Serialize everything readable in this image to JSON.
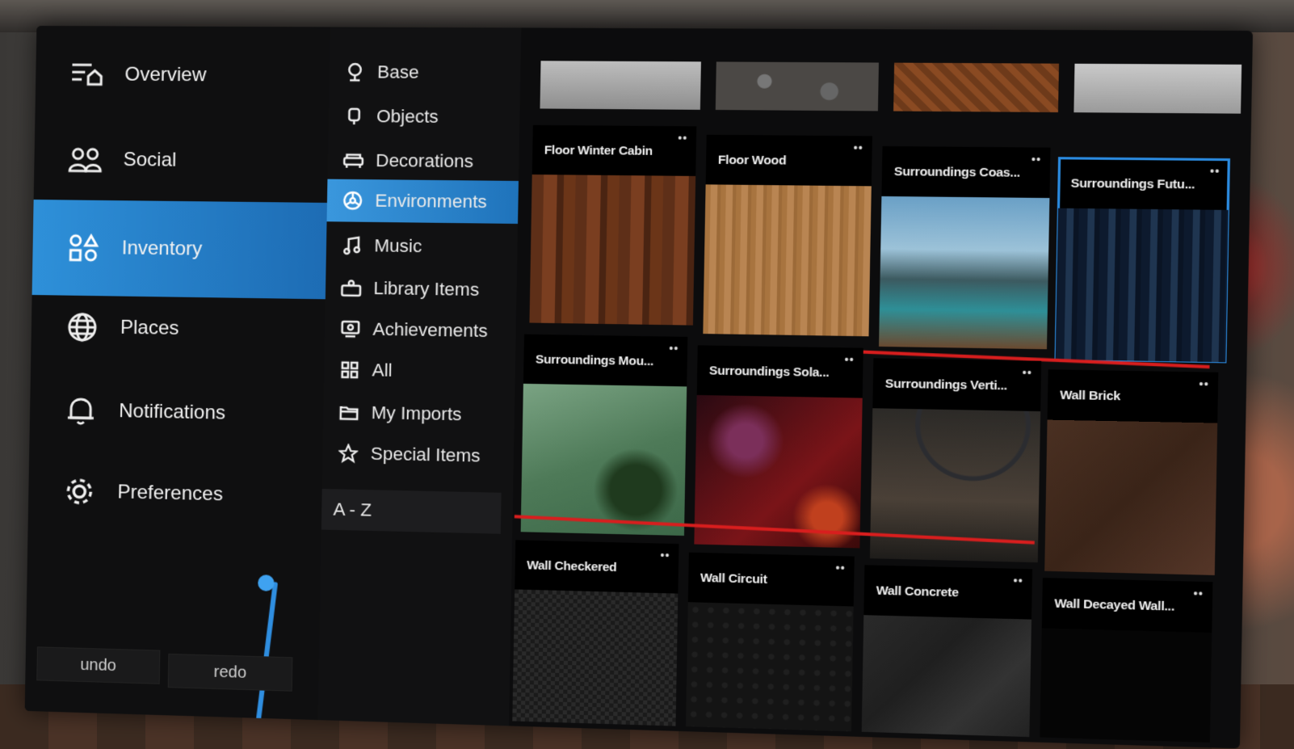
{
  "nav": {
    "items": [
      {
        "label": "Overview",
        "icon": "overview-icon"
      },
      {
        "label": "Social",
        "icon": "social-icon"
      },
      {
        "label": "Inventory",
        "icon": "inventory-icon",
        "active": true
      },
      {
        "label": "Places",
        "icon": "globe-icon"
      },
      {
        "label": "Notifications",
        "icon": "bell-icon"
      },
      {
        "label": "Preferences",
        "icon": "gear-icon"
      }
    ],
    "undo_label": "undo",
    "redo_label": "redo"
  },
  "subnav": {
    "items": [
      {
        "label": "Base",
        "icon": "base-icon"
      },
      {
        "label": "Objects",
        "icon": "objects-icon"
      },
      {
        "label": "Decorations",
        "icon": "decorations-icon"
      },
      {
        "label": "Environments",
        "icon": "environments-icon",
        "active": true
      },
      {
        "label": "Music",
        "icon": "music-icon"
      },
      {
        "label": "Library Items",
        "icon": "library-icon"
      },
      {
        "label": "Achievements",
        "icon": "achievements-icon"
      },
      {
        "label": "All",
        "icon": "grid-icon"
      },
      {
        "label": "My Imports",
        "icon": "folder-icon"
      },
      {
        "label": "Special Items",
        "icon": "star-icon"
      }
    ],
    "sort_label": "A - Z"
  },
  "grid": {
    "more_glyph": "••",
    "items": [
      {
        "title": "Floor Winter Cabin",
        "thumb": "wood-dark"
      },
      {
        "title": "Floor Wood",
        "thumb": "wood-light"
      },
      {
        "title": "Surroundings Coas...",
        "thumb": "coastal"
      },
      {
        "title": "Surroundings Futu...",
        "thumb": "future",
        "selected": true
      },
      {
        "title": "Surroundings Mou...",
        "thumb": "mountain"
      },
      {
        "title": "Surroundings Sola...",
        "thumb": "solar"
      },
      {
        "title": "Surroundings Verti...",
        "thumb": "vertical"
      },
      {
        "title": "Wall Brick",
        "thumb": "brick"
      },
      {
        "title": "Wall Checkered",
        "thumb": "checkered"
      },
      {
        "title": "Wall Circuit",
        "thumb": "circuit"
      },
      {
        "title": "Wall Concrete",
        "thumb": "concrete"
      },
      {
        "title": "Wall Decayed Wall...",
        "thumb": "decayed"
      }
    ]
  },
  "colors": {
    "accent": "#2b8be0",
    "highlight_line": "#d81e1e",
    "panel_bg": "#0c0c0d"
  }
}
